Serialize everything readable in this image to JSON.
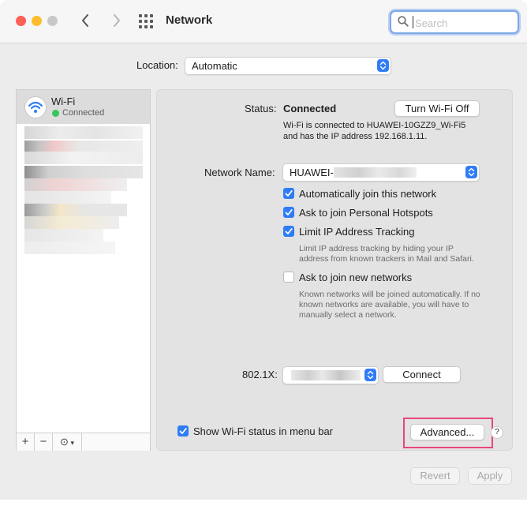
{
  "window": {
    "title": "Network"
  },
  "toolbar": {
    "search_placeholder": "Search"
  },
  "location": {
    "label": "Location:",
    "value": "Automatic"
  },
  "sidebar": {
    "selected": {
      "name": "Wi-Fi",
      "status": "Connected",
      "status_color": "#34c759"
    },
    "footer": {
      "add": "+",
      "remove": "−",
      "action": "⊙"
    }
  },
  "wifi": {
    "status_label": "Status:",
    "status_value": "Connected",
    "turn_off_label": "Turn Wi-Fi Off",
    "status_desc_line1": "Wi-Fi is connected to HUAWEI-10GZZ9_Wi-Fi5",
    "status_desc_line2": "and has the IP address 192.168.1.11.",
    "network_name_label": "Network Name:",
    "network_name_value": "HUAWEI-",
    "auto_join_label": "Automatically join this network",
    "auto_join_checked": true,
    "hotspots_label": "Ask to join Personal Hotspots",
    "hotspots_checked": true,
    "limit_ip_label": "Limit IP Address Tracking",
    "limit_ip_checked": true,
    "limit_ip_desc_line1": "Limit IP address tracking by hiding your IP",
    "limit_ip_desc_line2": "address from known trackers in Mail and Safari.",
    "ask_new_label": "Ask to join new networks",
    "ask_new_checked": false,
    "ask_new_desc_line1": "Known networks will be joined automatically. If no",
    "ask_new_desc_line2": "known networks are available, you will have to",
    "ask_new_desc_line3": "manually select a network.",
    "dot1x_label": "802.1X:",
    "connect_label": "Connect",
    "menu_bar_label": "Show Wi-Fi status in menu bar",
    "menu_bar_checked": true,
    "advanced_label": "Advanced...",
    "help_label": "?"
  },
  "footer": {
    "revert_label": "Revert",
    "apply_label": "Apply"
  },
  "colors": {
    "accent": "#2f7cf6",
    "highlight": "#e8477a"
  }
}
